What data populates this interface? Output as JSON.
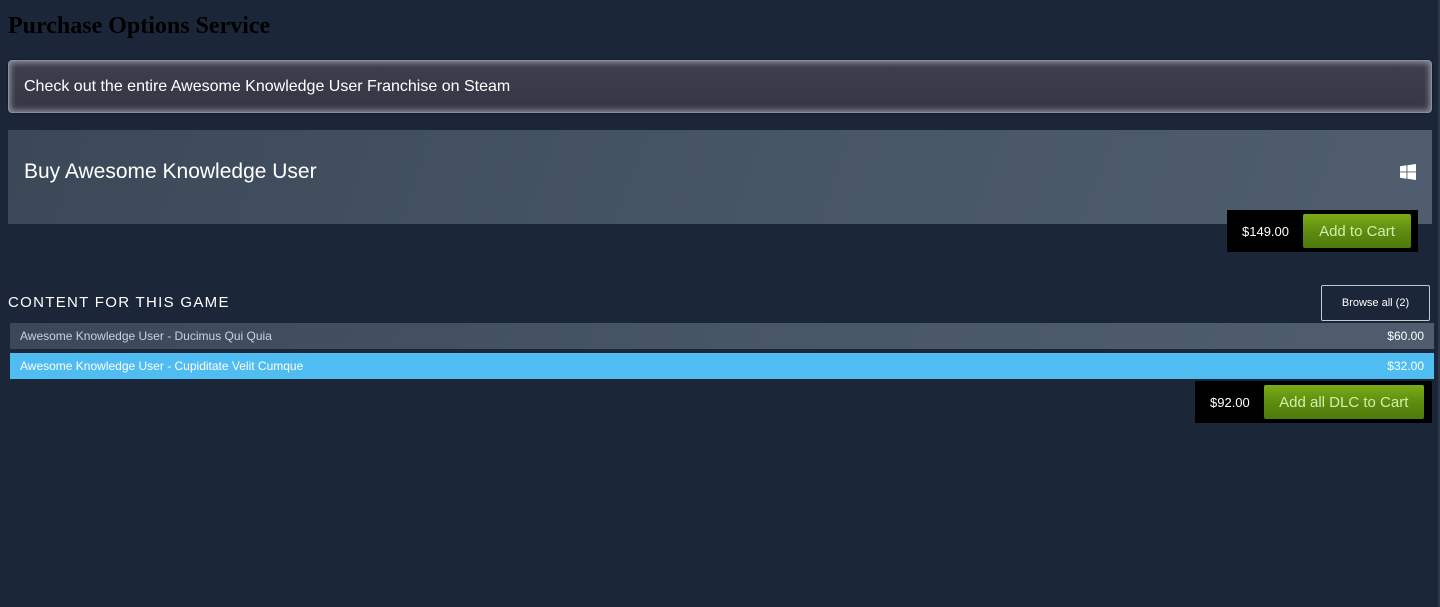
{
  "page": {
    "title": "Purchase Options Service"
  },
  "franchise": {
    "banner_text": "Check out the entire Awesome Knowledge User Franchise on Steam"
  },
  "game_purchase": {
    "title": "Buy Awesome Knowledge User",
    "platform_icon": "windows-icon",
    "price": "$149.00",
    "add_to_cart_label": "Add to Cart"
  },
  "dlc": {
    "heading": "CONTENT FOR THIS GAME",
    "browse_all_label": "Browse all (2)",
    "items": [
      {
        "name": "Awesome Knowledge User - Ducimus Qui Quia",
        "price": "$60.00",
        "selected": false
      },
      {
        "name": "Awesome Knowledge User - Cupiditate Velit Cumque",
        "price": "$32.00",
        "selected": true
      }
    ],
    "total_price": "$92.00",
    "add_all_label": "Add all DLC to Cart"
  },
  "colors": {
    "background": "#1b2738",
    "cart_button_green": "#5c8a10",
    "selected_row": "#4fbdf2",
    "text_white": "#ffffff"
  }
}
